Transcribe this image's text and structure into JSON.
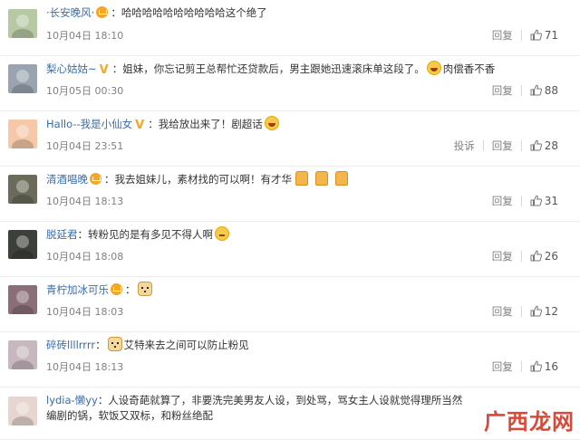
{
  "comments": [
    {
      "username": "·长安晚风·",
      "badge": "crown",
      "sep": "：",
      "text": "哈哈哈哈哈哈哈哈哈哈这个绝了",
      "emojis_after": [],
      "time": "10月04日 18:10",
      "actions": [
        "回复"
      ],
      "likes": "71",
      "avatar_color": "#b7c8a4"
    },
    {
      "username": "梨心姑姑~",
      "badge": "v",
      "sep": "：",
      "text": "姐妹，你忘记剪王总帮忙还贷款后，男主跟她迅速滚床单这段了。",
      "emojis_after": [
        "laugh"
      ],
      "tail": "肉偿香不香",
      "time": "10月05日 00:30",
      "actions": [
        "回复"
      ],
      "likes": "88",
      "avatar_color": "#9aa4b0"
    },
    {
      "username": "Hallo--我是小仙女",
      "badge": "v",
      "sep": "：",
      "text": "我给放出来了！剧超话",
      "emojis_after": [
        "laugh"
      ],
      "time": "10月04日 23:51",
      "actions": [
        "投诉",
        "回复"
      ],
      "likes": "28",
      "avatar_color": "#f4c8a8"
    },
    {
      "username": "清酒唱晚",
      "badge": "crown",
      "sep": "：",
      "text": "我去姐妹儿，素材找的可以啊！有才华",
      "emojis_after": [
        "thumb",
        "thumb",
        "thumb"
      ],
      "time": "10月04日 18:13",
      "actions": [
        "回复"
      ],
      "likes": "31",
      "avatar_color": "#6b6b5a"
    },
    {
      "username": "脱延君",
      "badge": "",
      "sep": "：",
      "text": "转粉见的是有多见不得人啊",
      "emojis_after": [
        "think"
      ],
      "time": "10月04日 18:08",
      "actions": [
        "回复"
      ],
      "likes": "26",
      "avatar_color": "#3c3f3a"
    },
    {
      "username": "青柠加冰可乐",
      "badge": "crown",
      "sep": "：",
      "text": "",
      "emojis_after": [
        "dog"
      ],
      "time": "10月04日 18:03",
      "actions": [
        "回复"
      ],
      "likes": "12",
      "avatar_color": "#8a6f78"
    },
    {
      "username": "碎砖llllrrrr",
      "badge": "",
      "sep": "：",
      "text": "艾特来去之间可以防止粉见",
      "emojis_before": [
        "dog"
      ],
      "emojis_after": [],
      "time": "10月04日 18:13",
      "actions": [
        "回复"
      ],
      "likes": "16",
      "avatar_color": "#c7b8bf"
    },
    {
      "username": "lydia-懒yy",
      "badge": "",
      "sep": "：",
      "text": "人设奇葩就算了，非要洗完美男友人设，到处骂，骂女主人设就觉得理所当然",
      "text2": "编剧的锅，软饭又双标，和粉丝绝配",
      "emojis_after": [],
      "time": "",
      "actions": [],
      "likes": "",
      "avatar_color": "#e7d6cf"
    }
  ],
  "watermark": "广西龙网",
  "colors": {
    "username": "#3b6ba5",
    "meta": "#808080",
    "crown": "#f6a623"
  }
}
